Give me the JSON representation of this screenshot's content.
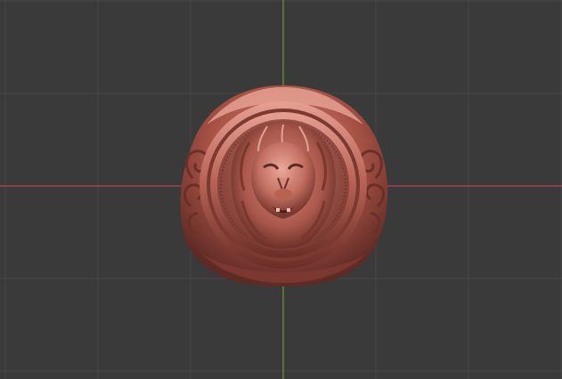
{
  "viewport": {
    "type": "3d-viewport",
    "projection": "orthographic",
    "view": "front",
    "grid": true,
    "colors": {
      "background": "#3a3a3a",
      "grid_line": "#474747",
      "x_axis": "#b5444f",
      "z_axis": "#6e9a2a",
      "material": "#b9665a",
      "material_highlight": "#e09a8c",
      "material_shadow": "#5e2a24"
    }
  },
  "object": {
    "kind": "signet-ring",
    "motif": "lion-head"
  }
}
